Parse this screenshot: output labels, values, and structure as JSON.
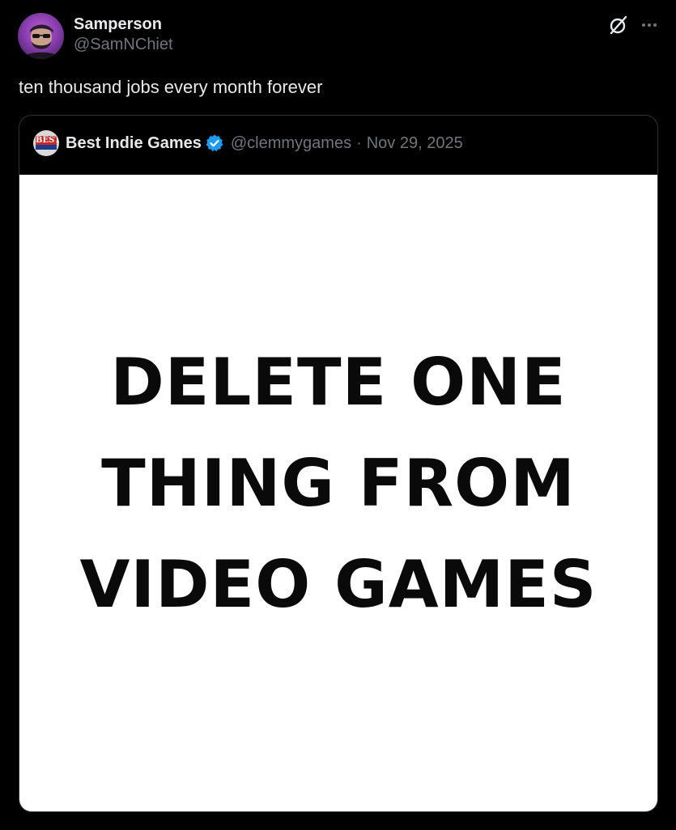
{
  "post": {
    "display_name": "Samperson",
    "handle": "@SamNChiet",
    "text": "ten thousand jobs every month forever"
  },
  "header_icons": {
    "grok": "grok-icon",
    "more": "more-icon"
  },
  "quoted_post": {
    "display_name": "Best Indie Games",
    "handle": "@clemmygames",
    "separator": "·",
    "date": "Nov 29, 2025",
    "verified": true,
    "image_text": {
      "line1": "DELETE ONE",
      "line2": "THING FROM",
      "line3": "VIDEO GAMES"
    },
    "avatar_logo_text": "BEST"
  },
  "colors": {
    "background": "#000000",
    "primary_text": "#e7e9ea",
    "secondary_text": "#71767b",
    "verified_badge": "#1d9bf0",
    "card_border": "#2f3336"
  }
}
